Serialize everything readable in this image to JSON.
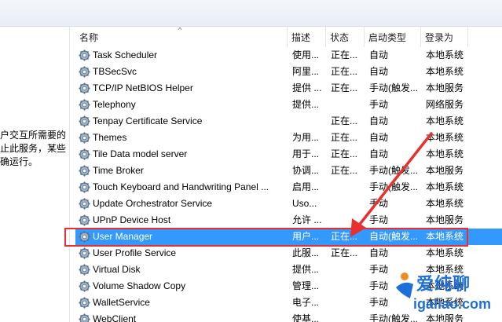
{
  "left_pane": {
    "description": "户交互所需要的\n止此服务，某些\n确运行。"
  },
  "columns": [
    {
      "key": "name",
      "label": "名称"
    },
    {
      "key": "desc",
      "label": "描述"
    },
    {
      "key": "status",
      "label": "状态"
    },
    {
      "key": "startup",
      "label": "启动类型"
    },
    {
      "key": "logon",
      "label": "登录为"
    }
  ],
  "sort_indicator": "^",
  "rows": [
    {
      "name": "Task Scheduler",
      "desc": "使用...",
      "status": "正在...",
      "startup": "自动",
      "logon": "本地系统"
    },
    {
      "name": "TBSecSvc",
      "desc": "阿里...",
      "status": "正在...",
      "startup": "自动",
      "logon": "本地系统"
    },
    {
      "name": "TCP/IP NetBIOS Helper",
      "desc": "提供 ...",
      "status": "正在...",
      "startup": "手动(触发...",
      "logon": "本地服务"
    },
    {
      "name": "Telephony",
      "desc": "提供...",
      "status": "",
      "startup": "手动",
      "logon": "网络服务"
    },
    {
      "name": "Tenpay Certificate Service",
      "desc": "",
      "status": "正在...",
      "startup": "自动",
      "logon": "本地系统"
    },
    {
      "name": "Themes",
      "desc": "为用...",
      "status": "正在...",
      "startup": "自动",
      "logon": "本地系统"
    },
    {
      "name": "Tile Data model server",
      "desc": "用于...",
      "status": "正在...",
      "startup": "自动",
      "logon": "本地系统"
    },
    {
      "name": "Time Broker",
      "desc": "协调...",
      "status": "正在...",
      "startup": "手动(触发...",
      "logon": "本地服务"
    },
    {
      "name": "Touch Keyboard and Handwriting Panel ...",
      "desc": "启用...",
      "status": "",
      "startup": "手动(触发...",
      "logon": "本地系统"
    },
    {
      "name": "Update Orchestrator Service",
      "desc": "Uso...",
      "status": "",
      "startup": "手动",
      "logon": "本地系统"
    },
    {
      "name": "UPnP Device Host",
      "desc": "允许 ...",
      "status": "",
      "startup": "手动",
      "logon": "本地服务"
    },
    {
      "name": "User Manager",
      "desc": "用户...",
      "status": "正在...",
      "startup": "自动(触发...",
      "logon": "本地系统",
      "selected": true
    },
    {
      "name": "User Profile Service",
      "desc": "此服...",
      "status": "正在...",
      "startup": "自动",
      "logon": "本地系统"
    },
    {
      "name": "Virtual Disk",
      "desc": "提供...",
      "status": "",
      "startup": "手动",
      "logon": "本地系统"
    },
    {
      "name": "Volume Shadow Copy",
      "desc": "管理...",
      "status": "",
      "startup": "手动",
      "logon": "本地系统"
    },
    {
      "name": "WalletService",
      "desc": "电子...",
      "status": "",
      "startup": "手动",
      "logon": "本地系统"
    },
    {
      "name": "WebClient",
      "desc": "使基...",
      "status": "",
      "startup": "手动(触发...",
      "logon": "本地服务"
    }
  ],
  "watermark": {
    "text_cn": "爱纯聊",
    "text_url": "igaliao.com"
  },
  "colors": {
    "selection": "#3399ff",
    "highlight_box": "#e8312f",
    "arrow": "#e8312f",
    "watermark": "#1e6fd9"
  },
  "icons": {
    "row_icon": "gear-icon"
  }
}
